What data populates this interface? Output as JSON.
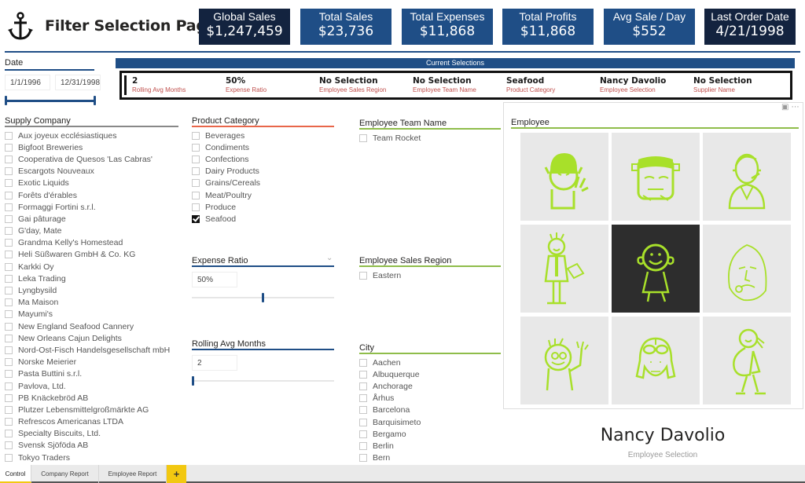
{
  "header": {
    "title": "Filter Selection Page",
    "icon": "anchor-icon"
  },
  "kpis": [
    {
      "label": "Global Sales",
      "value": "$1,247,459",
      "style": "dark"
    },
    {
      "label": "Total Sales",
      "value": "$23,736",
      "style": "blue"
    },
    {
      "label": "Total Expenses",
      "value": "$11,868",
      "style": "blue"
    },
    {
      "label": "Total Profits",
      "value": "$11,868",
      "style": "blue"
    },
    {
      "label": "Avg Sale / Day",
      "value": "$552",
      "style": "blue"
    },
    {
      "label": "Last Order Date",
      "value": "4/21/1998",
      "style": "dark"
    }
  ],
  "colors": {
    "navy": "#13233f",
    "blue": "#1f4e86",
    "accent_red": "#c0504d",
    "accent_orange": "#e8664a",
    "accent_green": "#8fbd4a",
    "icon_lime": "#a8e02a",
    "selected_tile": "#2d2d2d",
    "tab_yellow": "#f2c811"
  },
  "date_slicer": {
    "title": "Date",
    "start": "1/1/1996",
    "end": "12/31/1998",
    "range_fraction": [
      0,
      1
    ]
  },
  "current_selections": {
    "title": "Current Selections",
    "items": [
      {
        "value": "2",
        "label": "Rolling Avg Months"
      },
      {
        "value": "50%",
        "label": "Expense Ratio"
      },
      {
        "value": "No Selection",
        "label": "Employee Sales Region"
      },
      {
        "value": "No Selection",
        "label": "Employee Team Name"
      },
      {
        "value": "Seafood",
        "label": "Product Category"
      },
      {
        "value": "Nancy Davolio",
        "label": "Employee Selection"
      },
      {
        "value": "No Selection",
        "label": "Supplier Name"
      }
    ]
  },
  "supply_company": {
    "title": "Supply Company",
    "items": [
      "Aux joyeux ecclésiastiques",
      "Bigfoot Breweries",
      "Cooperativa de Quesos 'Las Cabras'",
      "Escargots Nouveaux",
      "Exotic Liquids",
      "Forêts d'érables",
      "Formaggi Fortini s.r.l.",
      "Gai pâturage",
      "G'day, Mate",
      "Grandma Kelly's Homestead",
      "Heli Süßwaren GmbH & Co. KG",
      "Karkki Oy",
      "Leka Trading",
      "Lyngbysild",
      "Ma Maison",
      "Mayumi's",
      "New England Seafood Cannery",
      "New Orleans Cajun Delights",
      "Nord-Ost-Fisch Handelsgesellschaft mbH",
      "Norske Meierier",
      "Pasta Buttini s.r.l.",
      "Pavlova, Ltd.",
      "PB Knäckebröd AB",
      "Plutzer Lebensmittelgroßmärkte AG",
      "Refrescos Americanas LTDA",
      "Specialty Biscuits, Ltd.",
      "Svensk Sjöföda AB",
      "Tokyo Traders"
    ]
  },
  "product_category": {
    "title": "Product Category",
    "items": [
      {
        "label": "Beverages",
        "checked": false
      },
      {
        "label": "Condiments",
        "checked": false
      },
      {
        "label": "Confections",
        "checked": false
      },
      {
        "label": "Dairy Products",
        "checked": false
      },
      {
        "label": "Grains/Cereals",
        "checked": false
      },
      {
        "label": "Meat/Poultry",
        "checked": false
      },
      {
        "label": "Produce",
        "checked": false
      },
      {
        "label": "Seafood",
        "checked": true
      }
    ]
  },
  "expense_ratio": {
    "title": "Expense Ratio",
    "value": "50%",
    "slider_fraction": 0.5
  },
  "rolling_avg": {
    "title": "Rolling Avg Months",
    "value": "2",
    "slider_fraction": 0
  },
  "employee_team": {
    "title": "Employee Team Name",
    "items": [
      "Team Rocket"
    ]
  },
  "employee_region": {
    "title": "Employee Sales Region",
    "items": [
      "Eastern"
    ]
  },
  "city": {
    "title": "City",
    "items": [
      "Aachen",
      "Albuquerque",
      "Anchorage",
      "Århus",
      "Barcelona",
      "Barquisimeto",
      "Bergamo",
      "Berlin",
      "Bern"
    ]
  },
  "employee": {
    "title": "Employee",
    "tiles": [
      {
        "icon": "vulcan-avatar-icon",
        "selected": false
      },
      {
        "icon": "frankenstein-avatar-icon",
        "selected": false
      },
      {
        "icon": "headset-woman-avatar-icon",
        "selected": false
      },
      {
        "icon": "businessman-stick-avatar-icon",
        "selected": false
      },
      {
        "icon": "curly-girl-avatar-icon",
        "selected": true
      },
      {
        "icon": "bearded-old-man-avatar-icon",
        "selected": false
      },
      {
        "icon": "waving-kid-avatar-icon",
        "selected": false
      },
      {
        "icon": "aviator-avatar-icon",
        "selected": false
      },
      {
        "icon": "pregnant-woman-avatar-icon",
        "selected": false
      }
    ],
    "selected_name": "Nancy Davolio",
    "selected_caption": "Employee Selection"
  },
  "tabs": [
    {
      "label": "Control",
      "active": true
    },
    {
      "label": "Company Report",
      "active": false
    },
    {
      "label": "Employee Report",
      "active": false
    }
  ],
  "add_tab_label": "+"
}
